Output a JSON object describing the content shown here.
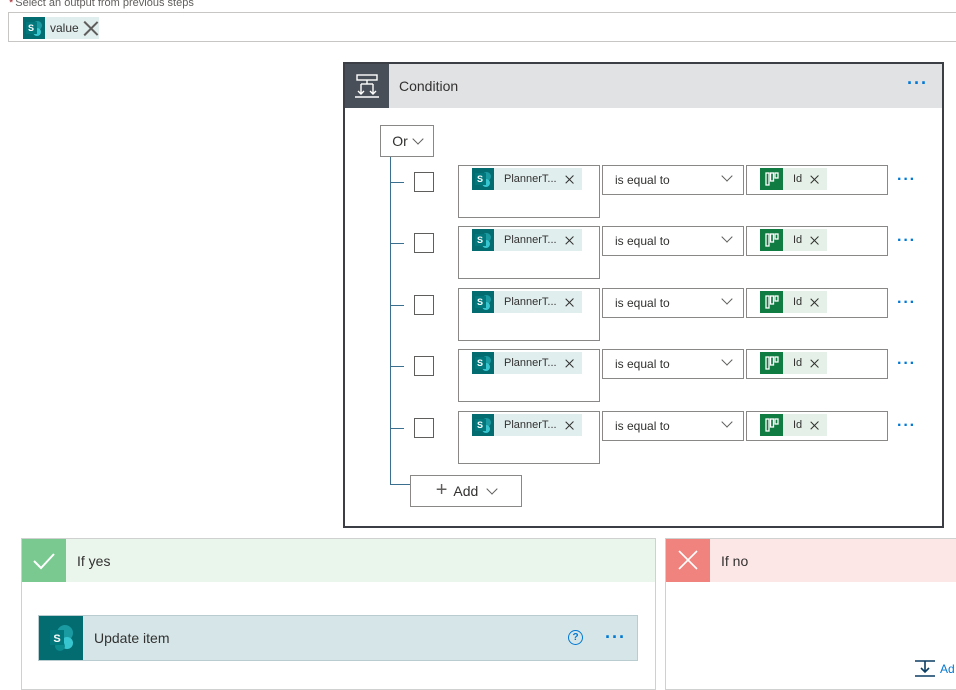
{
  "select_field": {
    "required_marker": "*",
    "label": "Select an output from previous steps",
    "token": {
      "label": "value",
      "icon": "sharepoint-icon"
    }
  },
  "condition": {
    "title": "Condition",
    "menu_icon": "ellipsis-icon",
    "group_operator": "Or",
    "rows": [
      {
        "left_token": "PlannerT...",
        "operator": "is equal to",
        "right_token": "Id"
      },
      {
        "left_token": "PlannerT...",
        "operator": "is equal to",
        "right_token": "Id"
      },
      {
        "left_token": "PlannerT...",
        "operator": "is equal to",
        "right_token": "Id"
      },
      {
        "left_token": "PlannerT...",
        "operator": "is equal to",
        "right_token": "Id"
      },
      {
        "left_token": "PlannerT...",
        "operator": "is equal to",
        "right_token": "Id"
      }
    ],
    "add_label": "Add"
  },
  "if_yes": {
    "title": "If yes",
    "action": {
      "title": "Update item",
      "icon": "sharepoint-icon",
      "help_icon": "help-icon"
    }
  },
  "if_no": {
    "title": "If no",
    "add_action_label": "Ad"
  },
  "colors": {
    "accent": "#0078d4",
    "sharepoint": "#036c70",
    "planner": "#107c41",
    "yes": "#79c990",
    "no": "#f1837f",
    "condition_icon_bg": "#484f58"
  }
}
